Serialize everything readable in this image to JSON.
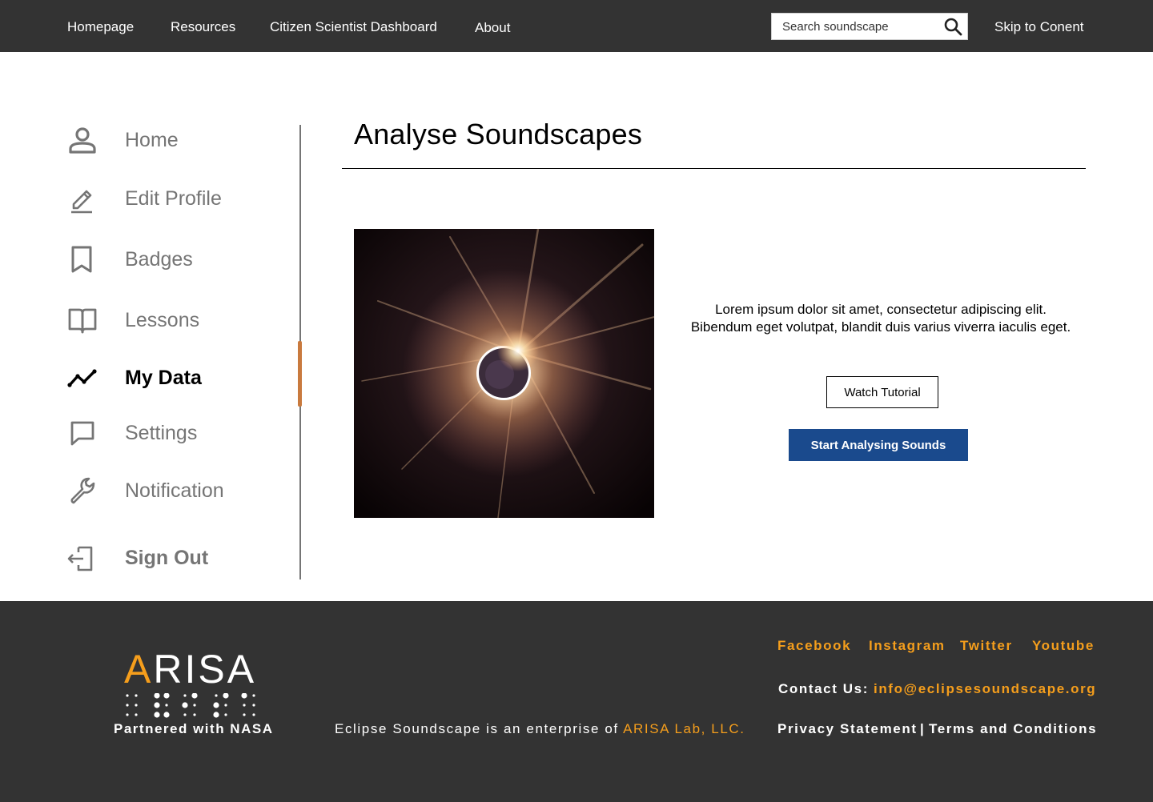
{
  "nav": {
    "links": [
      "Homepage",
      "Resources",
      "Citizen Scientist Dashboard",
      "About"
    ],
    "search_placeholder": "Search soundscape",
    "skip_link": "Skip to Conent"
  },
  "sidebar": {
    "items": [
      {
        "label": "Home",
        "icon": "person-icon"
      },
      {
        "label": "Edit Profile",
        "icon": "pencil-icon"
      },
      {
        "label": "Badges",
        "icon": "bookmark-icon"
      },
      {
        "label": "Lessons",
        "icon": "book-icon"
      },
      {
        "label": "My Data",
        "icon": "trend-line-icon",
        "active": true
      },
      {
        "label": "Settings",
        "icon": "chat-bubble-icon"
      },
      {
        "label": "Notification",
        "icon": "wrench-icon"
      },
      {
        "label": "Sign Out",
        "icon": "sign-out-icon"
      }
    ],
    "active_color": "#c97a3e"
  },
  "main": {
    "title": "Analyse Soundscapes",
    "image_alt": "solar eclipse",
    "description_line1": "Lorem ipsum dolor sit amet, consectetur adipiscing elit.",
    "description_line2": "Bibendum eget volutpat, blandit duis varius viverra iaculis eget.",
    "tutorial_button": "Watch Tutorial",
    "start_button": "Start Analysing Sounds",
    "start_button_color": "#1a4a8d"
  },
  "footer": {
    "logo_accent": "A",
    "logo_rest": "RISA",
    "partner": "Partnered with NASA",
    "enterprise_prefix": "Eclipse Soundscape is an enterprise of ",
    "enterprise_org": "ARISA Lab, LLC.",
    "social": [
      "Facebook",
      "Instagram",
      "Twitter",
      "Youtube"
    ],
    "contact_label": "Contact Us:",
    "contact_email": "info@eclipsesoundscape.org",
    "privacy": "Privacy Statement",
    "separator": "|",
    "terms": "Terms and Conditions",
    "accent_color": "#f59e1c",
    "background_color": "#333333"
  }
}
